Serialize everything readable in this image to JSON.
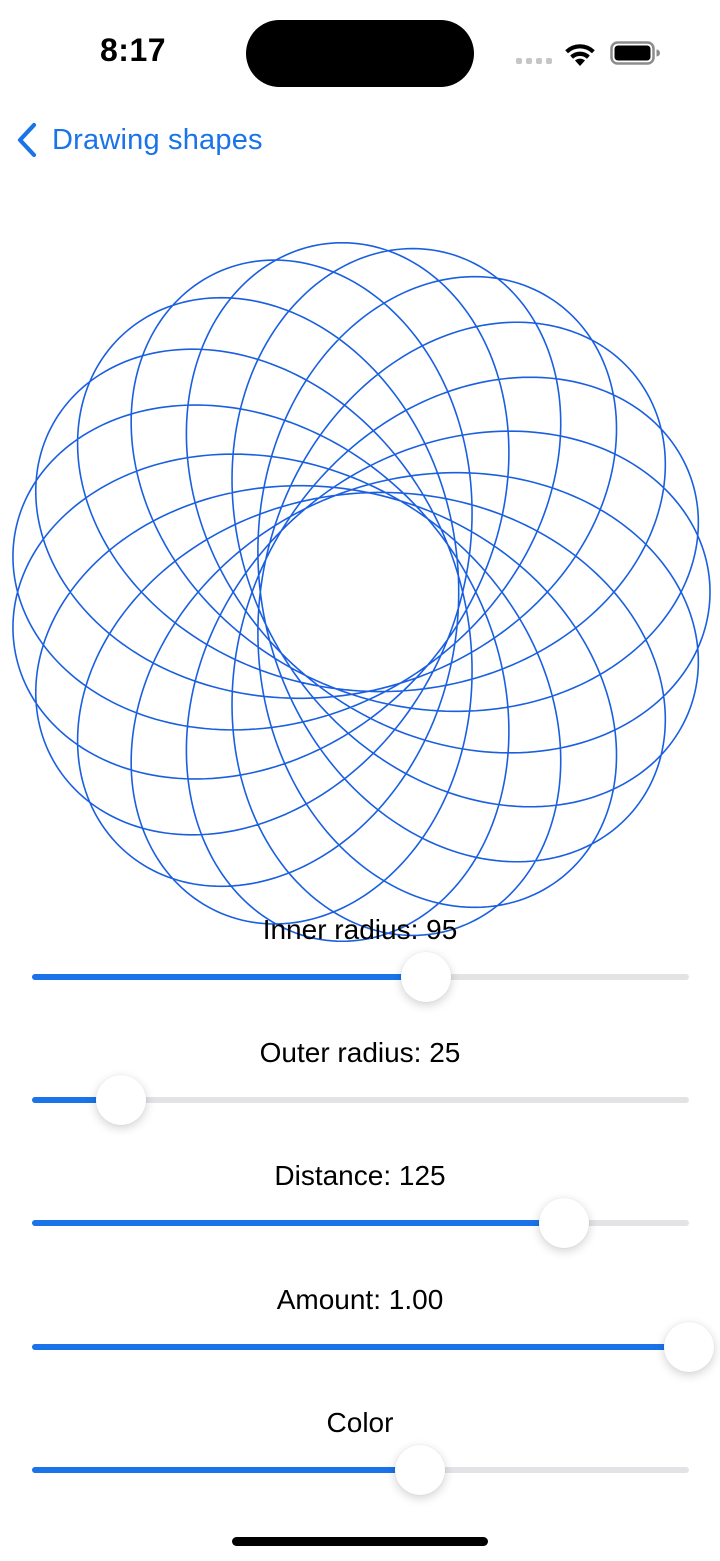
{
  "status_bar": {
    "time": "8:17"
  },
  "nav": {
    "back_label": "Drawing shapes",
    "back_icon": "chevron-left-icon"
  },
  "colors": {
    "accent": "#1a73e8",
    "stroke": "#1a5fe0",
    "track": "#e3e3e6"
  },
  "spirograph": {
    "inner_radius": 95,
    "outer_radius": 25,
    "distance": 125,
    "amount": 1.0
  },
  "controls": [
    {
      "label": "Inner radius: 95",
      "value": 0.6
    },
    {
      "label": "Outer radius: 25",
      "value": 0.135
    },
    {
      "label": "Distance: 125",
      "value": 0.81
    },
    {
      "label": "Amount: 1.00",
      "value": 1.0
    },
    {
      "label": "Color",
      "value": 0.59
    }
  ]
}
